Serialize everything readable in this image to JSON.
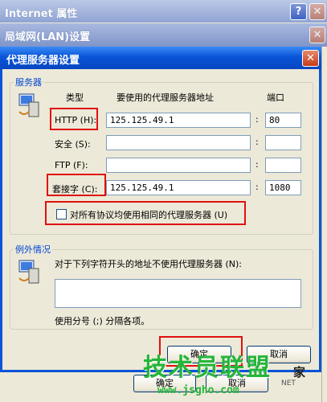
{
  "window_back": {
    "title": "Internet 属性",
    "help_glyph": "?",
    "close_glyph": "✕"
  },
  "window_lan": {
    "title": "局域网(LAN)设置",
    "close_glyph": "✕"
  },
  "dialog": {
    "title": "代理服务器设置",
    "close_glyph": "✕",
    "servers": {
      "legend": "服务器",
      "col_type": "类型",
      "col_address": "要使用的代理服务器地址",
      "col_port": "端口",
      "rows": [
        {
          "label": "HTTP (H):",
          "address": "125.125.49.1",
          "port": "80"
        },
        {
          "label": "安全 (S):",
          "address": "",
          "port": ""
        },
        {
          "label": "FTP (F):",
          "address": "",
          "port": ""
        },
        {
          "label": "套接字 (C):",
          "address": "125.125.49.1",
          "port": "1080"
        }
      ],
      "colon": ":",
      "same_proxy_label": "对所有协议均使用相同的代理服务器 (U)",
      "same_proxy_checked": false
    },
    "exceptions": {
      "legend": "例外情况",
      "desc": "对于下列字符开头的地址不使用代理服务器 (N):",
      "value": "",
      "hint": "使用分号 (;) 分隔各项。"
    },
    "ok_label": "确定",
    "cancel_label": "取消"
  },
  "under_buttons": {
    "ok": "确定",
    "cancel": "取消"
  },
  "watermark": {
    "text": "技术员联盟",
    "url": "www.jsgho.com",
    "suffix": "家",
    "net": "NET"
  },
  "colors": {
    "accent": "#0a55d8",
    "highlight": "#e01010",
    "watermark": "#25b53a"
  }
}
